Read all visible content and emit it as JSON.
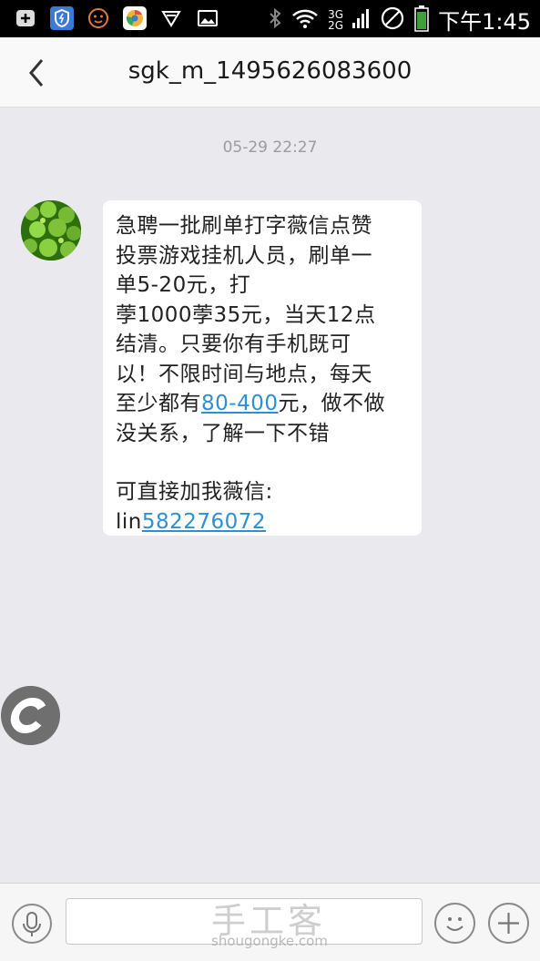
{
  "status_bar": {
    "network_top": "3G",
    "network_bottom": "2G",
    "time": "下午1:45",
    "icons": [
      "plus-box-icon",
      "shield-icon",
      "face-icon",
      "browser-icon",
      "vpn-icon",
      "image-icon",
      "bluetooth-icon",
      "wifi-icon",
      "signal-icon",
      "no-disturb-icon",
      "battery-icon"
    ]
  },
  "header": {
    "title": "sgk_m_1495626083600",
    "back_icon": "chevron-left-icon"
  },
  "conversation": {
    "timestamp": "05-29 22:27",
    "message": {
      "line1": "急聘一批刷单打字薇信点赞",
      "line2": "投票游戏挂机人员，刷单一",
      "line3": "单5-20元，打",
      "line4": "荸1000荸35元，当天12点",
      "line5": "结清。只要你有手机既可",
      "line6": "以！不限时间与地点，每天",
      "line7_pre": "至少都有",
      "line7_link": "80-400",
      "line7_post": "元，做不做",
      "line8": "没关系，了解一下不错",
      "line9": "可直接加我薇信:",
      "line10_pre": "lin",
      "line10_link": "582276072"
    }
  },
  "colors": {
    "link": "#2d8fd4",
    "background": "#e9e9ee",
    "bubble": "#ffffff"
  },
  "input_bar": {
    "placeholder": ""
  },
  "watermark": {
    "main": "手工客",
    "sub": "shougongke.com"
  }
}
